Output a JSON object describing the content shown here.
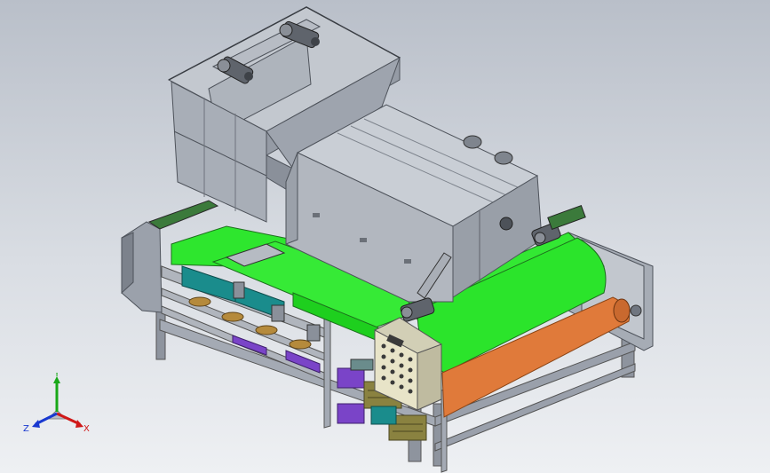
{
  "view": {
    "background_top": "#b9bfc9",
    "background_bottom": "#eef0f3"
  },
  "triad": {
    "x_label": "X",
    "y_label": "Y",
    "z_label": "Z",
    "x_color": "#d01818",
    "y_color": "#18a818",
    "z_color": "#1838d0"
  },
  "colors": {
    "frame": "#9aa0ab",
    "frame_dark": "#6e737c",
    "hopper": "#a7adb6",
    "housing": "#b6bbc3",
    "belt_green": "#2ee62e",
    "belt_orange": "#e07a3a",
    "panel": "#e6e2c8",
    "motor_purple": "#7a44c8",
    "teal": "#1a8c8c",
    "olive": "#8a8240"
  }
}
